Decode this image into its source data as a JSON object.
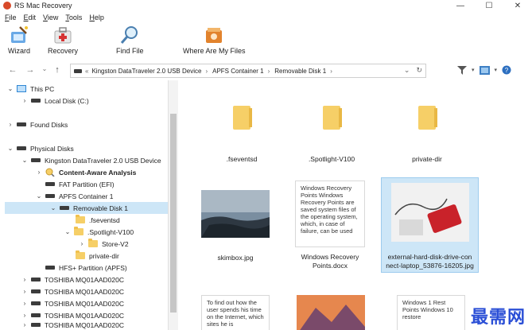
{
  "window": {
    "title": "RS Mac Recovery",
    "minimize": "—",
    "maximize": "☐",
    "close": "✕"
  },
  "menu": [
    {
      "accel": "F",
      "rest": "ile"
    },
    {
      "accel": "E",
      "rest": "dit"
    },
    {
      "accel": "V",
      "rest": "iew"
    },
    {
      "accel": "T",
      "rest": "ools"
    },
    {
      "accel": "H",
      "rest": "elp"
    }
  ],
  "toolbar": {
    "wizard": "Wizard",
    "recovery": "Recovery",
    "find_file": "Find File",
    "where_are_my_files": "Where Are My Files"
  },
  "address": {
    "prefix": "«",
    "crumbs": [
      "Kingston DataTraveler 2.0 USB Device",
      "APFS Container 1",
      "Removable Disk 1"
    ],
    "sep": "›",
    "dropdown": "⌄",
    "refresh": "↻"
  },
  "tree": {
    "this_pc": "This PC",
    "local_disk": "Local Disk (C:)",
    "found_disks": "Found Disks",
    "physical_disks": "Physical Disks",
    "kingston": "Kingston DataTraveler 2.0 USB Device",
    "content_aware": "Content-Aware Analysis",
    "fat": "FAT Partition (EFI)",
    "apfs": "APFS Container 1",
    "removable": "Removable Disk 1",
    "fseventsd": ".fseventsd",
    "spotlight": ".Spotlight-V100",
    "store": "Store-V2",
    "private_dir": "private-dir",
    "hfs": "HFS+ Partition (APFS)",
    "toshiba": [
      "TOSHIBA MQ01AAD020C",
      "TOSHIBA MQ01AAD020C",
      "TOSHIBA MQ01AAD020C",
      "TOSHIBA MQ01AAD020C",
      "TOSHIBA MQ01AAD020C"
    ]
  },
  "files": {
    "fseventsd": ".fseventsd",
    "spotlight": ".Spotlight-V100",
    "private_dir": "private-dir",
    "skimbox": "skimbox.jpg",
    "windows_points_line1": "Windows Recovery",
    "windows_points_line2": "Points.docx",
    "ext_line1": "external-hard-disk-drive-con",
    "ext_line2": "nect-laptop_53876-16205.jpg",
    "doc1_preview": "Windows Recovery Points Windows Recovery Points are saved system files of the operating system, which, in case of failure, can be used",
    "doc2_preview": "To find out how the user spends his time on the Internet, which sites he is",
    "doc3_preview": "Windows 1 Rest Points Windows 10 restore"
  },
  "watermark": "最需网",
  "colors": {
    "selection": "#cde6f7",
    "folder": "#f6cf67",
    "accent": "#2f86d3"
  }
}
